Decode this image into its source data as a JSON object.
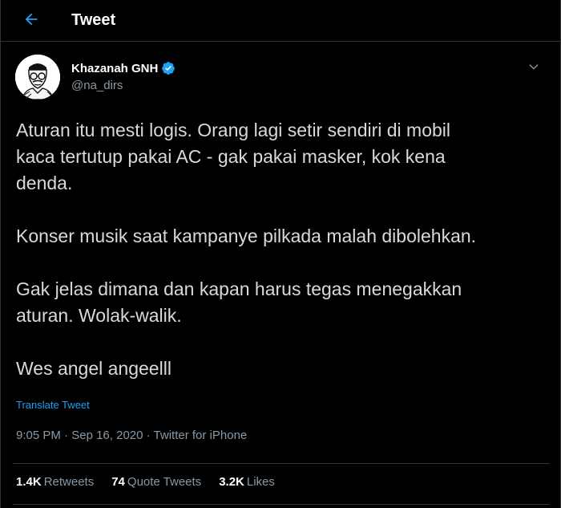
{
  "header": {
    "title": "Tweet",
    "back_icon": "arrow-left-icon",
    "accent": "#1da1f2"
  },
  "author": {
    "name": "Khazanah GNH",
    "handle": "@na_dirs",
    "verified": true,
    "avatar_icon": "avatar-caricature"
  },
  "tweet": {
    "lines": [
      "Aturan itu mesti logis. Orang lagi setir sendiri di mobil",
      "kaca tertutup pakai AC - gak pakai masker,  kok kena",
      "denda.",
      "Konser musik saat kampanye pilkada malah dibolehkan.",
      "Gak jelas dimana dan kapan  harus tegas menegakkan",
      "aturan. Wolak-walik.",
      "Wes angel angeelll"
    ],
    "translate_label": "Translate Tweet",
    "time": "9:05 PM",
    "date": "Sep 16, 2020",
    "separator": "·",
    "source": "Twitter for iPhone"
  },
  "stats": {
    "retweets_count": "1.4K",
    "retweets_label": "Retweets",
    "quotes_count": "74",
    "quotes_label": "Quote Tweets",
    "likes_count": "3.2K",
    "likes_label": "Likes"
  },
  "colors": {
    "background": "#000000",
    "text": "#d9d9d9",
    "muted": "#8899a6",
    "link": "#1da1f2",
    "border": "#2f3336"
  }
}
